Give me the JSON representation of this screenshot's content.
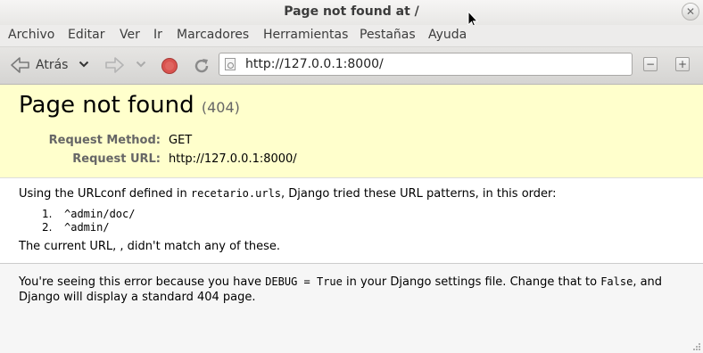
{
  "window": {
    "title": "Page not found at /"
  },
  "menu": [
    "Archivo",
    "Editar",
    "Ver",
    "Ir",
    "Marcadores",
    "Herramientas",
    "Pestañas",
    "Ayuda"
  ],
  "toolbar": {
    "back_label": "Atrás",
    "url": "http://127.0.0.1:8000/"
  },
  "page": {
    "heading": "Page not found",
    "status_code": "(404)",
    "request_method_label": "Request Method:",
    "request_method": "GET",
    "request_url_label": "Request URL:",
    "request_url": "http://127.0.0.1:8000/",
    "urlconf_prefix": "Using the URLconf defined in ",
    "urlconf_module": "recetario.urls",
    "urlconf_suffix": ", Django tried these URL patterns, in this order:",
    "patterns": [
      {
        "num": "1.",
        "pattern": "^admin/doc/"
      },
      {
        "num": "2.",
        "pattern": "^admin/"
      }
    ],
    "no_match": "The current URL, , didn't match any of these.",
    "explanation_1": "You're seeing this error because you have ",
    "explanation_code": "DEBUG = True",
    "explanation_2": " in your Django settings file. Change that to ",
    "explanation_code2": "False",
    "explanation_3": ", and Django will display a standard 404 page."
  },
  "colors": {
    "summary_bg": "#ffffcc",
    "explanation_bg": "#f6f6f6"
  }
}
